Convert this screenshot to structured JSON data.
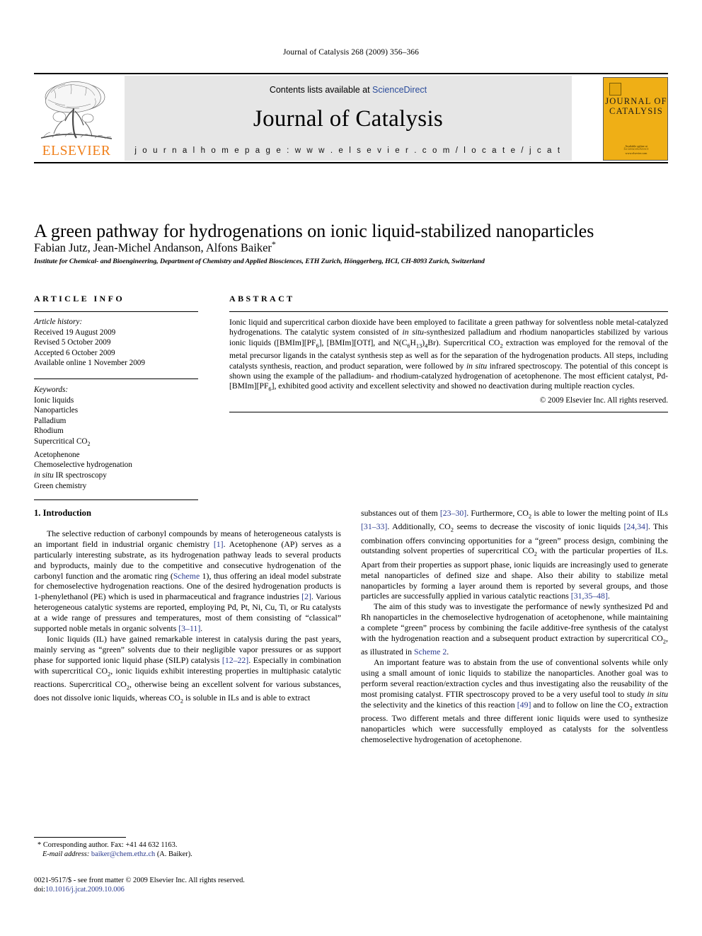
{
  "running_head": "Journal of Catalysis 268 (2009) 356–366",
  "masthead": {
    "contents_prefix": "Contents lists available at ",
    "contents_link": "ScienceDirect",
    "journal_title": "Journal of Catalysis",
    "homepage": "j o u r n a l   h o m e p a g e :   w w w . e l s e v i e r . c o m / l o c a t e / j c a t",
    "publisher_wordmark": "ELSEVIER",
    "cover_title_line1": "JOURNAL OF",
    "cover_title_line2": "CATALYSIS",
    "cover_footer_line1": "Available online at",
    "cover_footer_line2": "ScienceDirect",
    "cover_footer_line3": "www.elsevier.com",
    "accent_orange": "#F07F1A",
    "cover_amber": "#EFAF16",
    "link_blue": "#2b4c9b"
  },
  "article": {
    "title": "A green pathway for hydrogenations on ionic liquid-stabilized nanoparticles",
    "authors": "Fabian Jutz, Jean-Michel Andanson, Alfons Baiker",
    "corresponding_marker": "*",
    "affiliation": "Institute for Chemical- and Bioengineering, Department of Chemistry and Applied Biosciences, ETH Zurich, Hönggerberg, HCI, CH-8093 Zurich, Switzerland"
  },
  "article_info": {
    "heading": "ARTICLE INFO",
    "history_label": "Article history:",
    "history": [
      "Received 19 August 2009",
      "Revised 5 October 2009",
      "Accepted 6 October 2009",
      "Available online 1 November 2009"
    ],
    "keywords_label": "Keywords:",
    "keywords": [
      "Ionic liquids",
      "Nanoparticles",
      "Palladium",
      "Rhodium",
      "Supercritical CO2",
      "Acetophenone",
      "Chemoselective hydrogenation",
      "in situ IR spectroscopy",
      "Green chemistry"
    ]
  },
  "abstract": {
    "heading": "ABSTRACT",
    "text": "Ionic liquid and supercritical carbon dioxide have been employed to facilitate a green pathway for solventless noble metal-catalyzed hydrogenations. The catalytic system consisted of in situ-synthesized palladium and rhodium nanoparticles stabilized by various ionic liquids ([BMIm][PF6], [BMIm][OTf], and N(C6H13)4Br). Supercritical CO2 extraction was employed for the removal of the metal precursor ligands in the catalyst synthesis step as well as for the separation of the hydrogenation products. All steps, including catalysts synthesis, reaction, and product separation, were followed by in situ infrared spectroscopy. The potential of this concept is shown using the example of the palladium- and rhodium-catalyzed hydrogenation of acetophenone. The most efficient catalyst, Pd-[BMIm][PF6], exhibited good activity and excellent selectivity and showed no deactivation during multiple reaction cycles.",
    "copyright": "© 2009 Elsevier Inc. All rights reserved."
  },
  "introduction": {
    "heading": "1. Introduction",
    "left_paragraphs": [
      "The selective reduction of carbonyl compounds by means of heterogeneous catalysts is an important field in industrial organic chemistry [1]. Acetophenone (AP) serves as a particularly interesting substrate, as its hydrogenation pathway leads to several products and byproducts, mainly due to the competitive and consecutive hydrogenation of the carbonyl function and the aromatic ring (Scheme 1), thus offering an ideal model substrate for chemoselective hydrogenation reactions. One of the desired hydrogenation products is 1-phenylethanol (PE) which is used in pharmaceutical and fragrance industries [2]. Various heterogeneous catalytic systems are reported, employing Pd, Pt, Ni, Cu, Ti, or Ru catalysts at a wide range of pressures and temperatures, most of them consisting of \"classical\" supported noble metals in organic solvents [3–11].",
      "Ionic liquids (IL) have gained remarkable interest in catalysis during the past years, mainly serving as \"green\" solvents due to their negligible vapor pressures or as support phase for supported ionic liquid phase (SILP) catalysis [12–22]. Especially in combination with supercritical CO2, ionic liquids exhibit interesting properties in multiphasic catalytic reactions. Supercritical CO2, otherwise being an excellent solvent for various substances, does not dissolve ionic liquids, whereas CO2 is soluble in ILs and is able to extract"
    ],
    "right_paragraphs": [
      "substances out of them [23–30]. Furthermore, CO2 is able to lower the melting point of ILs [31–33]. Additionally, CO2 seems to decrease the viscosity of ionic liquids [24,34]. This combination offers convincing opportunities for a \"green\" process design, combining the outstanding solvent properties of supercritical CO2 with the particular properties of ILs. Apart from their properties as support phase, ionic liquids are increasingly used to generate metal nanoparticles of defined size and shape. Also their ability to stabilize metal nanoparticles by forming a layer around them is reported by several groups, and those particles are successfully applied in various catalytic reactions [31,35–48].",
      "The aim of this study was to investigate the performance of newly synthesized Pd and Rh nanoparticles in the chemoselective hydrogenation of acetophenone, while maintaining a complete \"green\" process by combining the facile additive-free synthesis of the catalyst with the hydrogenation reaction and a subsequent product extraction by supercritical CO2, as illustrated in Scheme 2.",
      "An important feature was to abstain from the use of conventional solvents while only using a small amount of ionic liquids to stabilize the nanoparticles. Another goal was to perform several reaction/extraction cycles and thus investigating also the reusability of the most promising catalyst. FTIR spectroscopy proved to be a very useful tool to study in situ the selectivity and the kinetics of this reaction [49] and to follow on line the CO2 extraction process. Two different metals and three different ionic liquids were used to synthesize nanoparticles which were successfully employed as catalysts for the solventless chemoselective hydrogenation of acetophenone."
    ]
  },
  "footnotes": {
    "corresponding": "Corresponding author. Fax: +41 44 632 1163.",
    "email_label": "E-mail address:",
    "email": "baiker@chem.ethz.ch",
    "email_suffix": "(A. Baiker)."
  },
  "imprint": {
    "line1": "0021-9517/$ - see front matter © 2009 Elsevier Inc. All rights reserved.",
    "doi_label": "doi:",
    "doi": "10.1016/j.jcat.2009.10.006"
  }
}
